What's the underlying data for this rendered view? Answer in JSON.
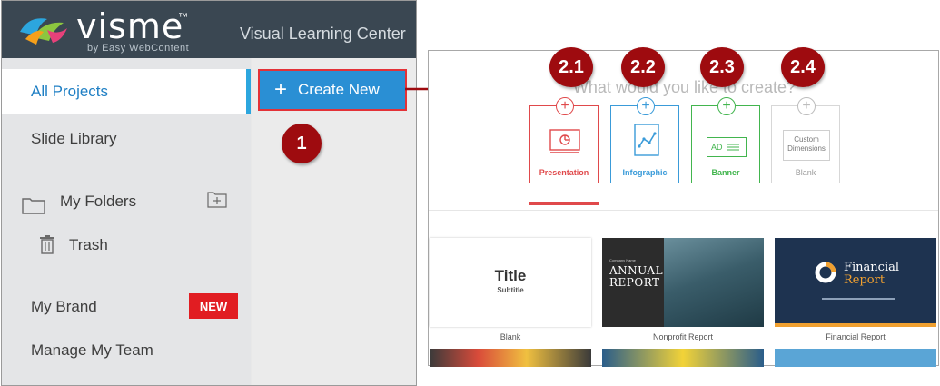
{
  "app": {
    "logo_text": "visme",
    "logo_tm": "™",
    "logo_subtext": "by Easy WebContent",
    "center_title": "Visual Learning Center"
  },
  "sidebar": {
    "items": [
      {
        "label": "All Projects",
        "active": true
      },
      {
        "label": "Slide Library",
        "active": false
      }
    ],
    "folders_label": "My Folders",
    "trash_label": "Trash",
    "brand_label": "My Brand",
    "brand_badge": "NEW",
    "team_label": "Manage My Team"
  },
  "create": {
    "button_label": "Create New",
    "button_icon": "plus-icon"
  },
  "steps": {
    "step_1": "1",
    "step_2_1": "2.1",
    "step_2_2": "2.2",
    "step_2_3": "2.3",
    "step_2_4": "2.4"
  },
  "dialog": {
    "prompt": "What would you like to create?",
    "types": [
      {
        "label": "Presentation",
        "color": "#e0494b"
      },
      {
        "label": "Infographic",
        "color": "#3a9bd9"
      },
      {
        "label": "Banner",
        "color": "#42b54e"
      },
      {
        "label": "Blank",
        "color": "#9a9a9a",
        "inner_line1": "Custom",
        "inner_line2": "Dimensions"
      }
    ],
    "banner_inner": "AD",
    "templates": [
      {
        "caption": "Blank",
        "title": "Title",
        "subtitle": "Subtitle"
      },
      {
        "caption": "Nonprofit Report",
        "company": "Company Name",
        "title_line1": "ANNUAL",
        "title_line2": "REPORT"
      },
      {
        "caption": "Financial Report",
        "title_line1": "Financial",
        "title_line2": "Report"
      }
    ]
  },
  "colors": {
    "topbar": "#3a4752",
    "accent_blue": "#2a8fd4",
    "step_red": "#9e0b0f",
    "highlight_red": "#e33237"
  }
}
